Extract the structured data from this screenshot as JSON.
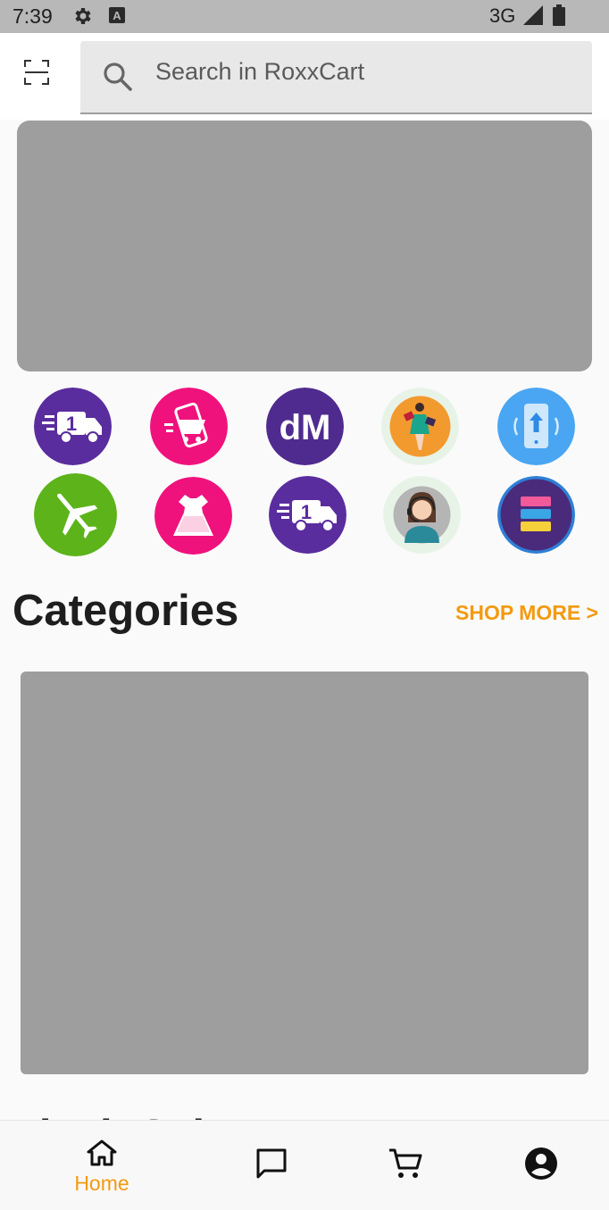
{
  "status_bar": {
    "time": "7:39",
    "network": "3G",
    "icons": [
      "gear-icon",
      "a-box-icon",
      "signal-icon",
      "battery-icon"
    ]
  },
  "header": {
    "scan_icon": "scan-icon",
    "search": {
      "placeholder": "Search in RoxxCart",
      "icon": "search-icon"
    }
  },
  "shortcuts": [
    {
      "icon": "delivery-truck-icon",
      "color": "#5a2d9e"
    },
    {
      "icon": "mobile-shopping-cart-icon",
      "color": "#f0127c"
    },
    {
      "icon": "dm-logo-icon",
      "color": "#4f2b8f"
    },
    {
      "icon": "sale-woman-icon",
      "color": "#f29a2e"
    },
    {
      "icon": "phone-upload-icon",
      "color": "#4aa6f2"
    },
    {
      "icon": "airplane-icon",
      "color": "#5db31a"
    },
    {
      "icon": "dress-icon",
      "color": "#f0127c"
    },
    {
      "icon": "delivery-truck-icon",
      "color": "#5a2d9e"
    },
    {
      "icon": "support-agent-icon",
      "color": "#b5b5b5"
    },
    {
      "icon": "stacked-cards-icon",
      "color": "#4a2a7a"
    }
  ],
  "categories": {
    "title": "Categories",
    "shop_more": "SHOP MORE >"
  },
  "flash_sale": {
    "title": "Flash Sale"
  },
  "bottom_nav": {
    "home_label": "Home",
    "active_color": "#f39a10",
    "items": [
      "home-icon",
      "chat-icon",
      "cart-icon",
      "account-icon"
    ]
  }
}
